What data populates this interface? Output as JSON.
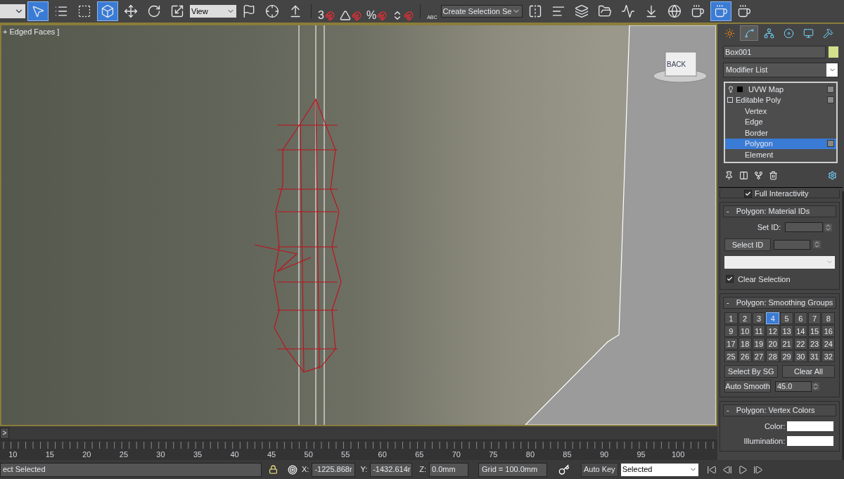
{
  "main_toolbar": {
    "tools_left": [
      {
        "kind": "select-object",
        "selected": true
      },
      {
        "kind": "select-by-name",
        "selected": false
      },
      {
        "kind": "region-select",
        "selected": false
      },
      {
        "kind": "window-crossing",
        "selected": true
      },
      {
        "kind": "move",
        "selected": false
      },
      {
        "kind": "rotate",
        "selected": false
      },
      {
        "kind": "scale",
        "selected": false
      }
    ],
    "reference_coordinate": "View",
    "tools_mid": [
      {
        "kind": "pivot-flag",
        "selected": false
      },
      {
        "kind": "pivot",
        "selected": false
      },
      {
        "kind": "placement",
        "selected": false
      }
    ],
    "snaps": [
      {
        "kind": "glyph",
        "glyph": "3"
      },
      {
        "kind": "angle"
      },
      {
        "kind": "glyph",
        "glyph": "%"
      },
      {
        "kind": "spinner"
      }
    ],
    "named_selection_glyph": "ABC",
    "named_selection": "Create Selection Se",
    "tools_right": [
      {
        "kind": "mirror",
        "selected": false
      },
      {
        "kind": "align",
        "selected": false
      },
      {
        "kind": "layers",
        "selected": false
      },
      {
        "kind": "scene-explorer",
        "selected": false
      },
      {
        "kind": "curve-editor",
        "selected": false
      },
      {
        "kind": "schematic",
        "selected": false
      },
      {
        "kind": "material-editor",
        "selected": false
      },
      {
        "kind": "render-setup",
        "selected": false
      },
      {
        "kind": "render-frame",
        "selected": true
      },
      {
        "kind": "render",
        "selected": false
      }
    ]
  },
  "viewport": {
    "label": "+ Edged Faces ]",
    "viewcube_label": "BACK"
  },
  "command_panel": {
    "tabs": [
      {
        "kind": "create",
        "selected": false
      },
      {
        "kind": "modify",
        "selected": true
      },
      {
        "kind": "hierarchy",
        "selected": false
      },
      {
        "kind": "motion",
        "selected": false
      },
      {
        "kind": "display",
        "selected": false
      },
      {
        "kind": "utilities",
        "selected": false
      }
    ],
    "object": {
      "name": "Box001",
      "color": "#d4e08c"
    },
    "modifier_list": "Modifier List",
    "stack": [
      {
        "label": "UVW Map",
        "expanded": false,
        "selected": false
      },
      {
        "label": "Editable Poly",
        "expanded": true,
        "selected": false,
        "children": [
          {
            "label": "Vertex",
            "selected": false
          },
          {
            "label": "Edge",
            "selected": false
          },
          {
            "label": "Border",
            "selected": false
          },
          {
            "label": "Polygon",
            "selected": true
          },
          {
            "label": "Element",
            "selected": false
          }
        ]
      }
    ],
    "partial_option": {
      "label": "Full Interactivity",
      "checked": true
    },
    "material_ids": {
      "collapse_glyph": "-",
      "title": "Polygon: Material IDs",
      "set_id_label": "Set ID:",
      "select_id_button": "Select ID",
      "clear_selection": {
        "label": "Clear Selection",
        "checked": true
      }
    },
    "smoothing_groups": {
      "collapse_glyph": "-",
      "title": "Polygon: Smoothing Groups",
      "groups": [
        {
          "label": "1",
          "selected": false
        },
        {
          "label": "2",
          "selected": false
        },
        {
          "label": "3",
          "selected": false
        },
        {
          "label": "4",
          "selected": true
        },
        {
          "label": "5",
          "selected": false
        },
        {
          "label": "6",
          "selected": false
        },
        {
          "label": "7",
          "selected": false
        },
        {
          "label": "8",
          "selected": false
        },
        {
          "label": "9",
          "selected": false
        },
        {
          "label": "10",
          "selected": false
        },
        {
          "label": "11",
          "selected": false
        },
        {
          "label": "12",
          "selected": false
        },
        {
          "label": "13",
          "selected": false
        },
        {
          "label": "14",
          "selected": false
        },
        {
          "label": "15",
          "selected": false
        },
        {
          "label": "16",
          "selected": false
        },
        {
          "label": "17",
          "selected": false
        },
        {
          "label": "18",
          "selected": false
        },
        {
          "label": "19",
          "selected": false
        },
        {
          "label": "20",
          "selected": false
        },
        {
          "label": "21",
          "selected": false
        },
        {
          "label": "22",
          "selected": false
        },
        {
          "label": "23",
          "selected": false
        },
        {
          "label": "24",
          "selected": false
        },
        {
          "label": "25",
          "selected": false
        },
        {
          "label": "26",
          "selected": false
        },
        {
          "label": "27",
          "selected": false
        },
        {
          "label": "28",
          "selected": false
        },
        {
          "label": "29",
          "selected": false
        },
        {
          "label": "30",
          "selected": false
        },
        {
          "label": "31",
          "selected": false
        },
        {
          "label": "32",
          "selected": false
        }
      ],
      "select_by_sg": "Select By SG",
      "clear_all": "Clear All",
      "auto_smooth": "Auto Smooth",
      "threshold": "45.0"
    },
    "vertex_colors": {
      "collapse_glyph": "-",
      "title": "Polygon: Vertex Colors",
      "color_label": "Color:",
      "illumination_label": "Illumination:"
    }
  },
  "timeline": {
    "next_button": ">",
    "ruler_labels": [
      "10",
      "15",
      "20",
      "25",
      "30",
      "35",
      "40",
      "45",
      "50",
      "55",
      "60",
      "65",
      "70",
      "75",
      "80",
      "85",
      "90",
      "95",
      "100"
    ]
  },
  "status_bar": {
    "prompt": "ect Selected",
    "x_label": "X:",
    "x_value": "-1225.868r",
    "y_label": "Y:",
    "y_value": "-1432.614r",
    "z_label": "Z:",
    "z_value": "0.0mm",
    "grid": "Grid = 100.0mm",
    "auto_key": "Auto Key",
    "key_filter": "Selected",
    "playback": [
      {
        "kind": "to-start"
      },
      {
        "kind": "prev-frame"
      },
      {
        "kind": "play"
      },
      {
        "kind": "next-frame"
      }
    ]
  }
}
